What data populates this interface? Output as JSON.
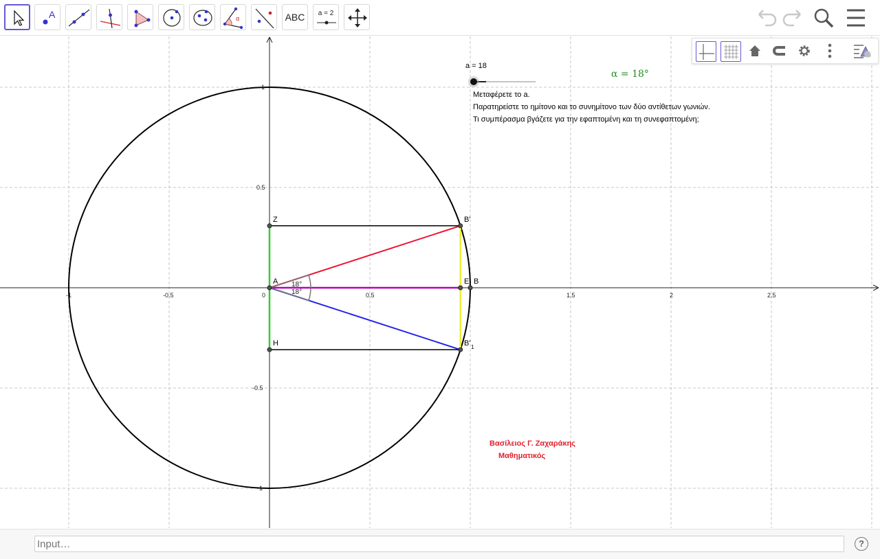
{
  "toolbar": {
    "tools": [
      {
        "name": "move-tool",
        "label": ""
      },
      {
        "name": "point-tool",
        "label": "A"
      },
      {
        "name": "line-tool",
        "label": ""
      },
      {
        "name": "perpendicular-tool",
        "label": ""
      },
      {
        "name": "polygon-tool",
        "label": ""
      },
      {
        "name": "circle-tool",
        "label": ""
      },
      {
        "name": "conic-tool",
        "label": ""
      },
      {
        "name": "angle-tool",
        "label": "α"
      },
      {
        "name": "reflect-tool",
        "label": ""
      },
      {
        "name": "text-tool",
        "label": "ABC"
      },
      {
        "name": "slider-tool",
        "label": "a = 2"
      },
      {
        "name": "move-view-tool",
        "label": ""
      }
    ]
  },
  "slider": {
    "label": "a = 18",
    "value": 18,
    "min": 0,
    "max": 90
  },
  "angle_text": "α  =  18°",
  "instructions": [
    "Μεταφέρετε το a.",
    "Παρατηρείστε το ημίτονο και το συνημίτονο των δύο αντίθετων γωνιών.",
    "Τι συμπέρασμα βγάζετε για την εφαπτομένη και τη συνεφαπτομένη;"
  ],
  "author": {
    "name": "Βασίλειος  Γ.  Ζαχαράκης",
    "title": "Μαθηματικός"
  },
  "axes": {
    "x_ticks": [
      "-1",
      "-0.5",
      "0",
      "0.5",
      "1.5",
      "2",
      "2.5"
    ],
    "y_ticks": [
      "1",
      "0.5",
      "-0.5",
      "-1"
    ]
  },
  "points": {
    "A": "A",
    "B": "B",
    "B_prime": "B'",
    "B1_prime": "B'",
    "B1_sub": "1",
    "Z": "Z",
    "H": "H",
    "E": "E"
  },
  "angle_labels": {
    "upper": "18°",
    "lower": "18°"
  },
  "colors": {
    "accent": "#6557d2",
    "green": "#33cc33",
    "red": "#ee1133",
    "blue": "#2222ee",
    "magenta": "#bb00bb",
    "yellow": "#eeee33",
    "alpha_text": "#228b22",
    "author": "#e0212e"
  },
  "input": {
    "placeholder": "Input…"
  },
  "help_label": "?"
}
